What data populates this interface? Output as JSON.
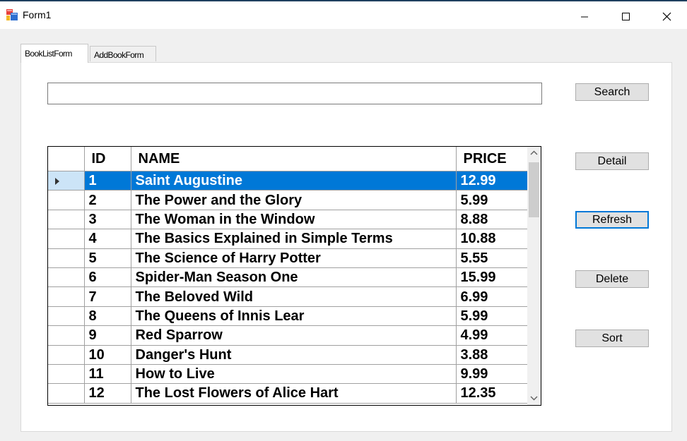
{
  "window": {
    "title": "Form1",
    "icon": "winforms-app-icon",
    "controls": [
      "minimize-icon",
      "maximize-icon",
      "close-icon"
    ]
  },
  "tabs": [
    {
      "label": "BookListForm",
      "active": true
    },
    {
      "label": "AddBookForm",
      "active": false
    }
  ],
  "search": {
    "value": "",
    "button_label": "Search"
  },
  "buttons": {
    "detail": "Detail",
    "refresh": "Refresh",
    "delete": "Delete",
    "sort": "Sort"
  },
  "grid": {
    "columns": [
      "ID",
      "NAME",
      "PRICE"
    ],
    "selected_row_index": 0,
    "rows": [
      {
        "id": "1",
        "name": "Saint Augustine",
        "price": "12.99"
      },
      {
        "id": "2",
        "name": "The Power and the Glory",
        "price": "5.99"
      },
      {
        "id": "3",
        "name": "The Woman in the Window",
        "price": "8.88"
      },
      {
        "id": "4",
        "name": "The Basics Explained in Simple Terms",
        "price": "10.88"
      },
      {
        "id": "5",
        "name": "The Science of Harry Potter",
        "price": "5.55"
      },
      {
        "id": "6",
        "name": "Spider-Man Season One",
        "price": "15.99"
      },
      {
        "id": "7",
        "name": "The Beloved Wild",
        "price": "6.99"
      },
      {
        "id": "8",
        "name": "The Queens of Innis Lear",
        "price": "5.99"
      },
      {
        "id": "9",
        "name": "Red Sparrow",
        "price": "4.99"
      },
      {
        "id": "10",
        "name": "Danger's Hunt",
        "price": "3.88"
      },
      {
        "id": "11",
        "name": "How to Live",
        "price": "9.99"
      },
      {
        "id": "12",
        "name": "The Lost Flowers of Alice Hart",
        "price": "12.35"
      }
    ]
  },
  "colors": {
    "selection": "#0078d7",
    "row_header_selected": "#cce4f7",
    "focus_border": "#0078d7"
  }
}
